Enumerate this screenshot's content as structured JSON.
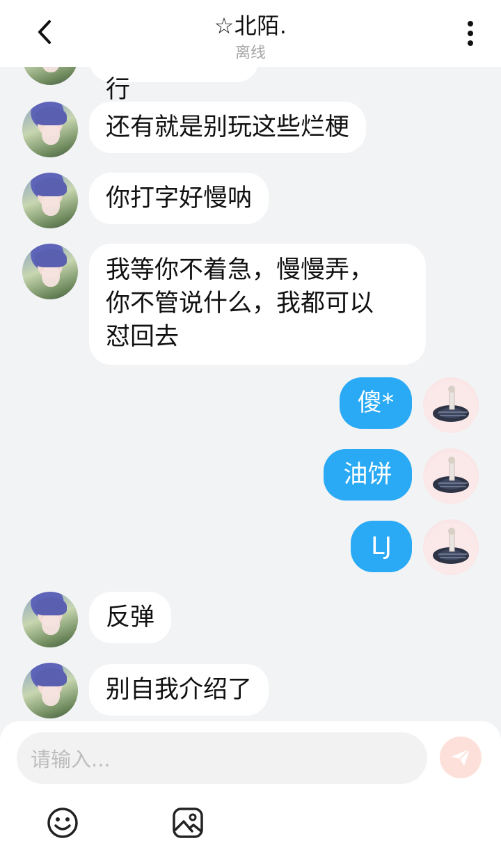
{
  "header": {
    "title": "☆北陌.",
    "status": "离线"
  },
  "messages": [
    {
      "sender": "friend",
      "text": "不 就 就 不 行"
    },
    {
      "sender": "friend",
      "text": "还有就是别玩这些烂梗"
    },
    {
      "sender": "friend",
      "text": "你打字好慢呐"
    },
    {
      "sender": "friend",
      "lines": [
        "我等你不着急，慢慢弄，",
        "你不管说什么，我都可以",
        "怼回去"
      ]
    },
    {
      "sender": "me",
      "text": "傻*"
    },
    {
      "sender": "me",
      "text": "油饼"
    },
    {
      "sender": "me",
      "text": "LJ"
    },
    {
      "sender": "friend",
      "text": "反弹"
    },
    {
      "sender": "friend",
      "text": "别自我介绍了"
    }
  ],
  "composer": {
    "placeholder": "请输入..."
  },
  "icons": {
    "back": "chevron-left-icon",
    "more": "more-vertical-icon",
    "send": "send-icon",
    "emoji": "emoji-icon",
    "image": "image-icon"
  },
  "colors": {
    "my_bubble": "#2aaaf5",
    "friend_bubble": "#ffffff",
    "background": "#f2f3f5",
    "send_button": "#fde0da"
  }
}
